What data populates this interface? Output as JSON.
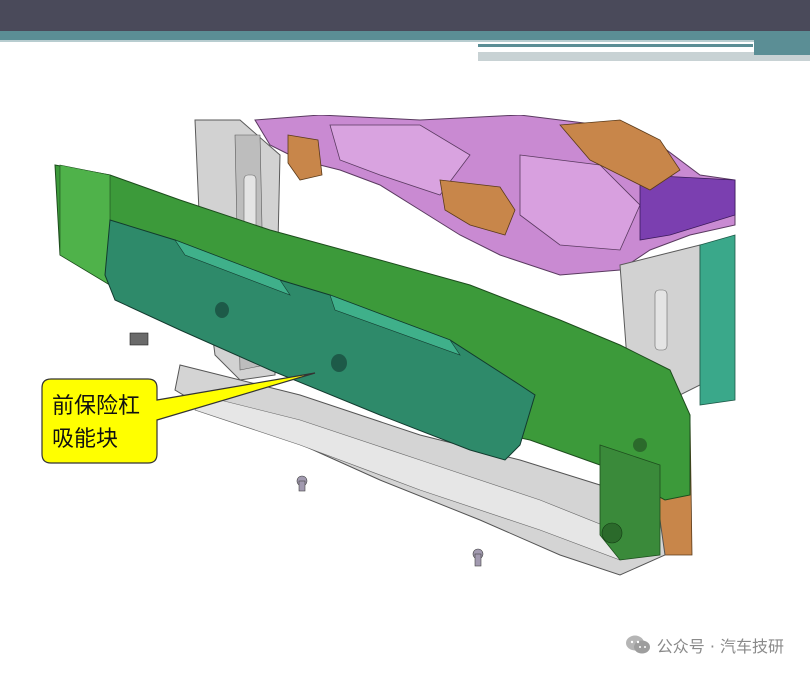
{
  "callout": {
    "line1": "前保险杠",
    "line2": "吸能块"
  },
  "watermark": {
    "icon": "wechat-icon",
    "text": "公众号 · 汽车技研"
  },
  "colors": {
    "header": "#4a4a5a",
    "accent": "#5b8e95",
    "callout_fill": "#ffff00",
    "absorber": "#2e8a6a",
    "beam": "#3c9a3a",
    "bracket": "#c8864a",
    "upper_panel": "#c77ed0",
    "frame": "#c9c9c9"
  }
}
